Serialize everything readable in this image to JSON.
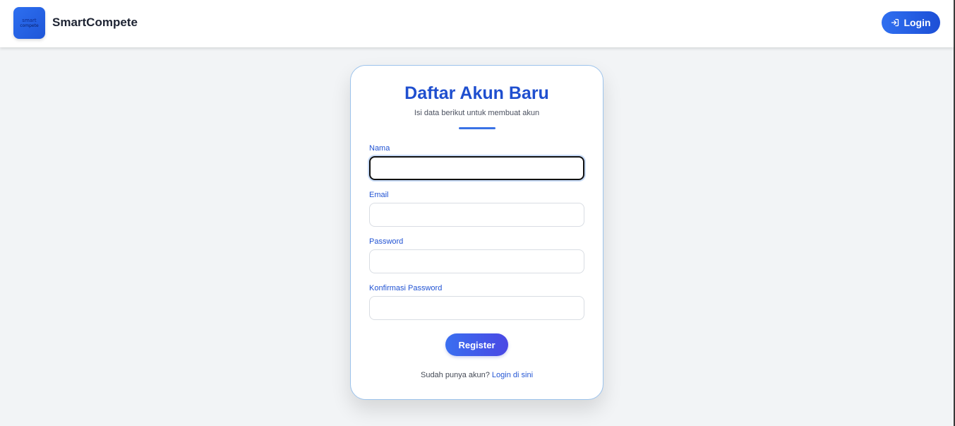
{
  "navbar": {
    "logo_line1": "smart",
    "logo_line2": "compete",
    "brand": "SmartCompete",
    "login_label": "Login",
    "login_icon": "login-arrow-icon"
  },
  "form": {
    "title": "Daftar Akun Baru",
    "subtitle": "Isi data berikut untuk membuat akun",
    "fields": [
      {
        "label": "Nama",
        "value": ""
      },
      {
        "label": "Email",
        "value": ""
      },
      {
        "label": "Password",
        "value": ""
      },
      {
        "label": "Konfirmasi Password",
        "value": ""
      }
    ],
    "submit_label": "Register",
    "footer_prompt": "Sudah punya akun?",
    "footer_link": "Login di sini"
  },
  "colors": {
    "accent": "#1f4fcf",
    "button_start": "#3a6ff0",
    "button_end": "#4a48e4",
    "card_border": "#9cc3ec",
    "background": "#f2f4f6"
  }
}
